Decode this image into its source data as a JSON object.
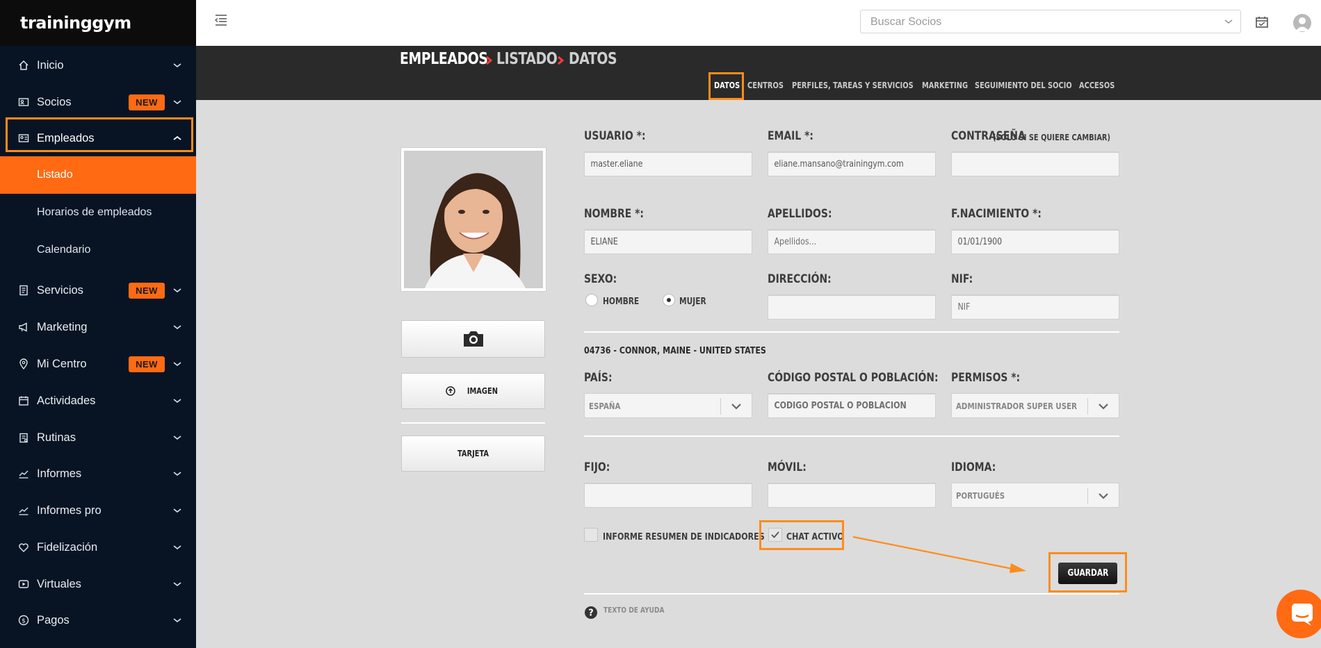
{
  "brand": {
    "logo_text": "traininggym"
  },
  "sidebar": {
    "items": [
      {
        "label": "Inicio",
        "icon": "home-icon"
      },
      {
        "label": "Socios",
        "icon": "id-card-icon",
        "badge": "NEW"
      },
      {
        "label": "Empleados",
        "icon": "employee-card-icon"
      },
      {
        "label": "Servicios",
        "icon": "document-icon",
        "badge": "NEW"
      },
      {
        "label": "Marketing",
        "icon": "megaphone-icon"
      },
      {
        "label": "Mi Centro",
        "icon": "location-pin-icon",
        "badge": "NEW"
      },
      {
        "label": "Actividades",
        "icon": "calendar-icon"
      },
      {
        "label": "Rutinas",
        "icon": "clipboard-icon"
      },
      {
        "label": "Informes",
        "icon": "chart-line-icon"
      },
      {
        "label": "Informes pro",
        "icon": "chart-line-icon"
      },
      {
        "label": "Fidelización",
        "icon": "heart-icon"
      },
      {
        "label": "Virtuales",
        "icon": "play-icon"
      },
      {
        "label": "Pagos",
        "icon": "dollar-icon"
      }
    ],
    "subitems": [
      {
        "label": "Listado"
      },
      {
        "label": "Horarios de empleados"
      },
      {
        "label": "Calendario"
      }
    ]
  },
  "topbar": {
    "search_placeholder": "Buscar Socios"
  },
  "breadcrumb": {
    "part1": "EMPLEADOS",
    "part2": "LISTADO",
    "part3": "DATOS"
  },
  "tabs": [
    {
      "label": "DATOS"
    },
    {
      "label": "CENTROS"
    },
    {
      "label": "PERFILES, TAREAS Y SERVICIOS"
    },
    {
      "label": "MARKETING"
    },
    {
      "label": "SEGUIMIENTO DEL SOCIO"
    },
    {
      "label": "ACCESOS"
    }
  ],
  "photo_panel": {
    "image_button": "IMAGEN",
    "card_button": "TARJETA"
  },
  "form": {
    "usuario": {
      "label": "USUARIO *:",
      "value": "master.eliane"
    },
    "email": {
      "label": "EMAIL *:",
      "value": "eliane.mansano@trainingym.com"
    },
    "password": {
      "label": "CONTRASEÑA",
      "hint": "(SOLO SI SE QUIERE CAMBIAR)",
      "value": ""
    },
    "nombre": {
      "label": "NOMBRE *:",
      "value": "ELIANE"
    },
    "apellidos": {
      "label": "APELLIDOS:",
      "placeholder": "Apellidos..."
    },
    "nacimiento": {
      "label": "F.NACIMIENTO *:",
      "value": "01/01/1900"
    },
    "sexo": {
      "label": "SEXO:",
      "options": [
        "HOMBRE",
        "MUJER"
      ],
      "selected": "MUJER"
    },
    "direccion": {
      "label": "DIRECCIÓN:",
      "value": ""
    },
    "nif": {
      "label": "NIF:",
      "placeholder": "NIF"
    },
    "location_text": "04736 - CONNOR, MAINE - UNITED STATES",
    "pais": {
      "label": "PAÍS:",
      "value": "ESPAÑA"
    },
    "codigo_postal": {
      "label": "CÓDIGO POSTAL O POBLACIÓN:",
      "placeholder": "CÓDIGO POSTAL O POBLACIÓN"
    },
    "permisos": {
      "label": "PERMISOS *:",
      "value": "ADMINISTRADOR SUPER USER"
    },
    "fijo": {
      "label": "FIJO:",
      "value": ""
    },
    "movil": {
      "label": "MÓVIL:",
      "value": ""
    },
    "idioma": {
      "label": "IDIOMA:",
      "value": "PORTUGUÉS"
    },
    "informe": {
      "label": "INFORME RESUMEN DE INDICADORES",
      "checked": false
    },
    "chat": {
      "label": "CHAT ACTIVO",
      "checked": true
    },
    "save": "GUARDAR",
    "help": "TEXTO DE AYUDA"
  },
  "colors": {
    "accent": "#ff6a13",
    "sidebar_bg": "#081424",
    "highlight": "#ff8c1a"
  }
}
